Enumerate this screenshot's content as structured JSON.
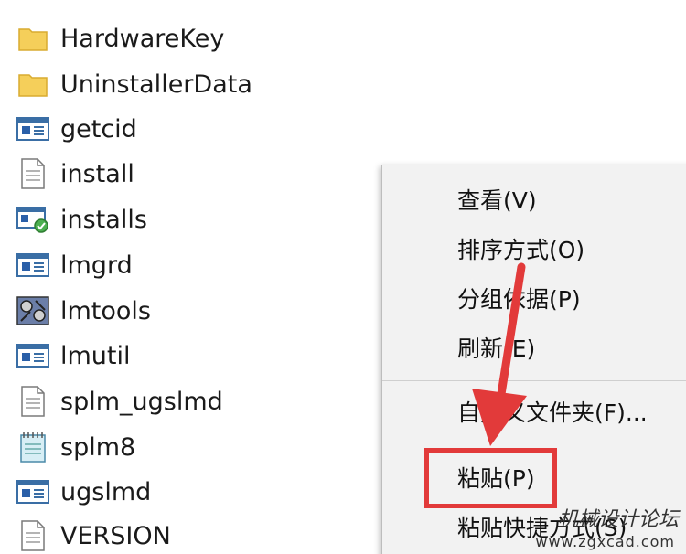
{
  "files": [
    {
      "name": "HardwareKey",
      "icon": "folder-icon"
    },
    {
      "name": "UninstallerData",
      "icon": "folder-icon"
    },
    {
      "name": "getcid",
      "icon": "exe-window-icon"
    },
    {
      "name": "install",
      "icon": "document-icon"
    },
    {
      "name": "installs",
      "icon": "installer-icon"
    },
    {
      "name": "lmgrd",
      "icon": "exe-window-icon"
    },
    {
      "name": "lmtools",
      "icon": "tools-icon"
    },
    {
      "name": "lmutil",
      "icon": "exe-window-icon"
    },
    {
      "name": "splm_ugslmd",
      "icon": "document-icon"
    },
    {
      "name": "splm8",
      "icon": "notepad-icon"
    },
    {
      "name": "ugslmd",
      "icon": "exe-window-icon"
    },
    {
      "name": "VERSION",
      "icon": "document-icon"
    }
  ],
  "context_menu": {
    "items": [
      {
        "label": "查看(V)"
      },
      {
        "label": "排序方式(O)"
      },
      {
        "label": "分组依据(P)"
      },
      {
        "label": "刷新(E)"
      },
      {
        "label": "自定义文件夹(F)..."
      },
      {
        "label": "粘贴(P)"
      },
      {
        "label": "粘贴快捷方式(S)"
      }
    ]
  },
  "watermark": {
    "text": "机械设计论坛",
    "url": "www.zgxcad.com"
  },
  "colors": {
    "annotation_red": "#e23a3a",
    "folder_yellow": "#f5cf5a",
    "menu_bg": "#f2f2f2"
  }
}
